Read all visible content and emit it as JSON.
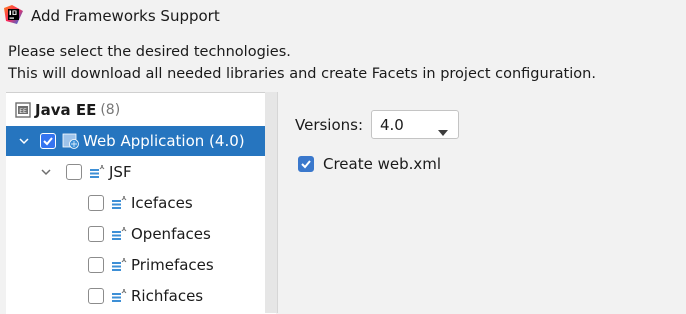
{
  "window": {
    "title": "Add Frameworks Support",
    "app_icon": "intellij-idea-icon"
  },
  "description": {
    "line1": "Please select the desired technologies.",
    "line2": "This will download all needed libraries and create Facets in project configuration."
  },
  "tree": {
    "items": [
      {
        "label": "Java EE",
        "count": "(8)",
        "icon": "java-ee-icon",
        "level": 0,
        "checkbox": false,
        "expander": "none",
        "selected": false
      },
      {
        "label": "Web Application (4.0)",
        "icon": "web-module-icon",
        "level": 1,
        "checkbox": true,
        "checked": true,
        "expander": "expanded",
        "selected": true
      },
      {
        "label": "JSF",
        "icon": "jsf-icon",
        "level": 2,
        "checkbox": true,
        "checked": false,
        "expander": "expanded",
        "selected": false
      },
      {
        "label": "Icefaces",
        "icon": "jsf-component-icon",
        "level": 3,
        "checkbox": true,
        "checked": false,
        "expander": "none",
        "selected": false
      },
      {
        "label": "Openfaces",
        "icon": "jsf-component-icon",
        "level": 3,
        "checkbox": true,
        "checked": false,
        "expander": "none",
        "selected": false
      },
      {
        "label": "Primefaces",
        "icon": "jsf-component-icon",
        "level": 3,
        "checkbox": true,
        "checked": false,
        "expander": "none",
        "selected": false
      },
      {
        "label": "Richfaces",
        "icon": "jsf-component-icon",
        "level": 3,
        "checkbox": true,
        "checked": false,
        "expander": "none",
        "selected": false
      }
    ]
  },
  "settings": {
    "versions_label": "Versions:",
    "versions_value": "4.0",
    "create_webxml_label": "Create web.xml",
    "create_webxml_checked": true
  },
  "colors": {
    "selection": "#2675bf",
    "checkbox_checked": "#3a78cc",
    "background": "#f2f2f2"
  }
}
